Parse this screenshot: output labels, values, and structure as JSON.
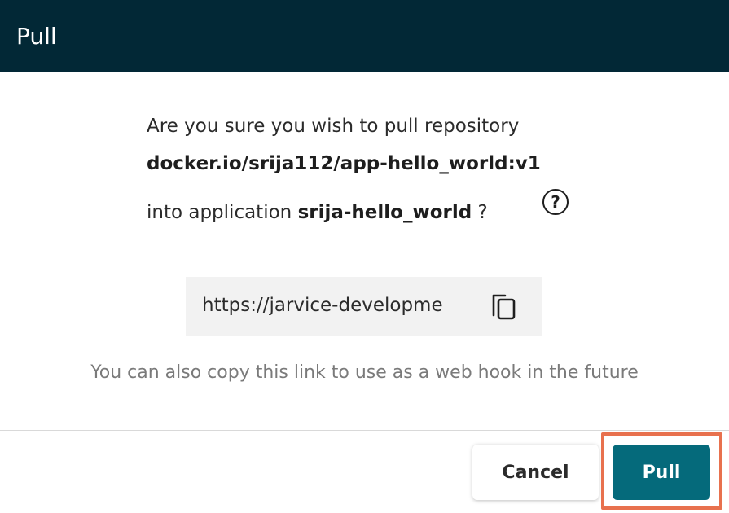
{
  "dialog": {
    "title": "Pull"
  },
  "message": {
    "line1": "Are you sure you wish to pull repository",
    "repository": "docker.io/srija112/app-hello_world:v1",
    "line3_prefix": "into application ",
    "application": "srija-hello_world",
    "line3_suffix": " ?",
    "help_icon": "help-circle-icon"
  },
  "webhook": {
    "url_visible": "https://jarvice-developme",
    "copy_icon": "copy-icon",
    "hint": "You can also copy this link to use as a web hook in the future"
  },
  "actions": {
    "cancel_label": "Cancel",
    "pull_label": "Pull"
  },
  "colors": {
    "header_bg": "#022836",
    "primary_button": "#056a7b",
    "highlight_outline": "#e8714e"
  }
}
